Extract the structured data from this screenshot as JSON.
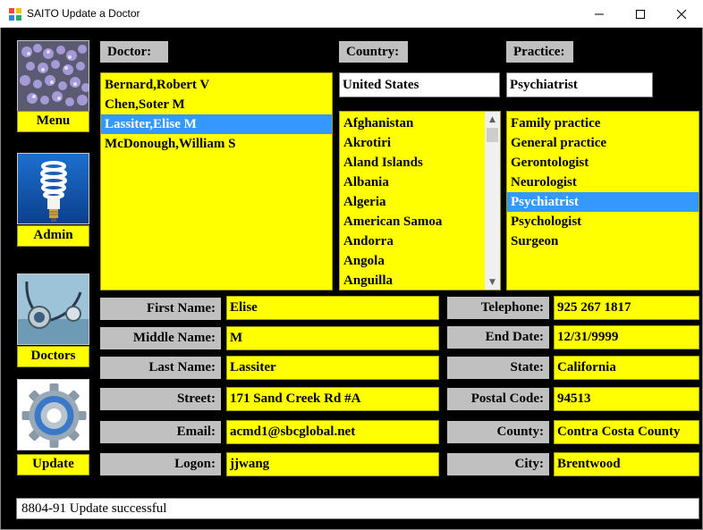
{
  "window": {
    "title": "SAITO Update a Doctor"
  },
  "nav": {
    "menu_label": "Menu",
    "admin_label": "Admin",
    "doctors_label": "Doctors",
    "update_label": "Update"
  },
  "headers": {
    "doctor": "Doctor:",
    "country": "Country:",
    "practice": "Practice:"
  },
  "doctors": {
    "items": [
      "Bernard,Robert V",
      "Chen,Soter M",
      "Lassiter,Elise M",
      "McDonough,William S"
    ],
    "selected": "Lassiter,Elise M"
  },
  "country": {
    "value": "United States",
    "items": [
      "Afghanistan",
      "Akrotiri",
      "Aland Islands",
      "Albania",
      "Algeria",
      "American Samoa",
      "Andorra",
      "Angola",
      "Anguilla"
    ]
  },
  "practice": {
    "value": "Psychiatrist",
    "items": [
      "Family practice",
      "General practice",
      "Gerontologist",
      "Neurologist",
      "Psychiatrist",
      "Psychologist",
      "Surgeon"
    ],
    "selected": "Psychiatrist"
  },
  "form": {
    "first_name_label": "First Name:",
    "first_name": "Elise",
    "middle_name_label": "Middle Name:",
    "middle_name": "M",
    "last_name_label": "Last Name:",
    "last_name": "Lassiter",
    "street_label": "Street:",
    "street": "171 Sand Creek Rd #A",
    "email_label": "Email:",
    "email": "acmd1@sbcglobal.net",
    "logon_label": "Logon:",
    "logon": "jjwang",
    "telephone_label": "Telephone:",
    "telephone": "925 267 1817",
    "end_date_label": "End Date:",
    "end_date": "12/31/9999",
    "state_label": "State:",
    "state": "California",
    "postal_code_label": "Postal Code:",
    "postal_code": "94513",
    "county_label": "County:",
    "county": "Contra Costa County",
    "city_label": "City:",
    "city": "Brentwood"
  },
  "status": {
    "message": "8804-91 Update successful"
  },
  "colors": {
    "field_bg": "#ffff00",
    "label_bg": "#c0c0c0",
    "selection": "#3399ff",
    "client_bg": "#000000"
  }
}
